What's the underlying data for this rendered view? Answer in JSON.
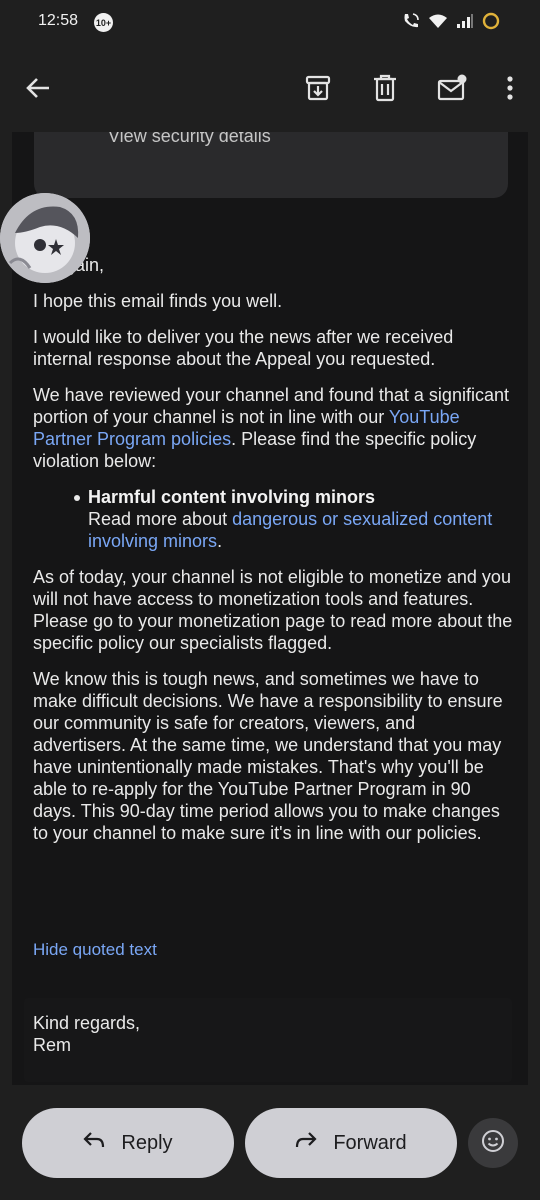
{
  "status_bar": {
    "time": "12:58",
    "notification_badge": "10+",
    "icons": [
      "wifi-calling-icon",
      "wifi-icon",
      "signal-icon",
      "battery-ring-icon"
    ]
  },
  "app_bar": {
    "icons": [
      "back-arrow-icon",
      "archive-icon",
      "delete-icon",
      "mark-unread-icon",
      "more-vert-icon"
    ]
  },
  "email": {
    "security_link": "View security details",
    "greeting": "Hi again,",
    "para1": "I hope this email finds you well.",
    "para2": "I would like to deliver you the news after we received internal response about the Appeal you requested.",
    "para3_start": "We have reviewed your channel and found that a significant portion of your channel is not in line with our ",
    "para3_link": "YouTube Partner Program policies",
    "para3_end": ". Please find the specific policy violation below:",
    "bullet_title": "Harmful content involving minors",
    "bullet_read_more": "Read more about ",
    "bullet_link": "dangerous or sexualized content involving minors",
    "bullet_end": ".",
    "para4": "As of today, your channel is not eligible to monetize and you will not have access to monetization tools and features. Please go to your monetization page to read more about the specific policy our specialists flagged.",
    "para5": "We know this is tough news, and sometimes we have to make difficult decisions. We have a responsibility to ensure our community is safe for creators, viewers, and advertisers. At the same time, we understand that you may have unintentionally made mistakes. That's why you'll be able to re-apply for the YouTube Partner Program in 90 days. This 90-day time period allows you to make changes to your channel to make sure it's in line with our policies.",
    "hide_quoted": "Hide quoted text",
    "signoff_line1": "Kind regards,",
    "signoff_line2": "Rem"
  },
  "actions": {
    "reply": "Reply",
    "forward": "Forward"
  },
  "colors": {
    "background": "#1f1f1f",
    "link": "#7aa7f5",
    "button": "#cfcfd4"
  }
}
